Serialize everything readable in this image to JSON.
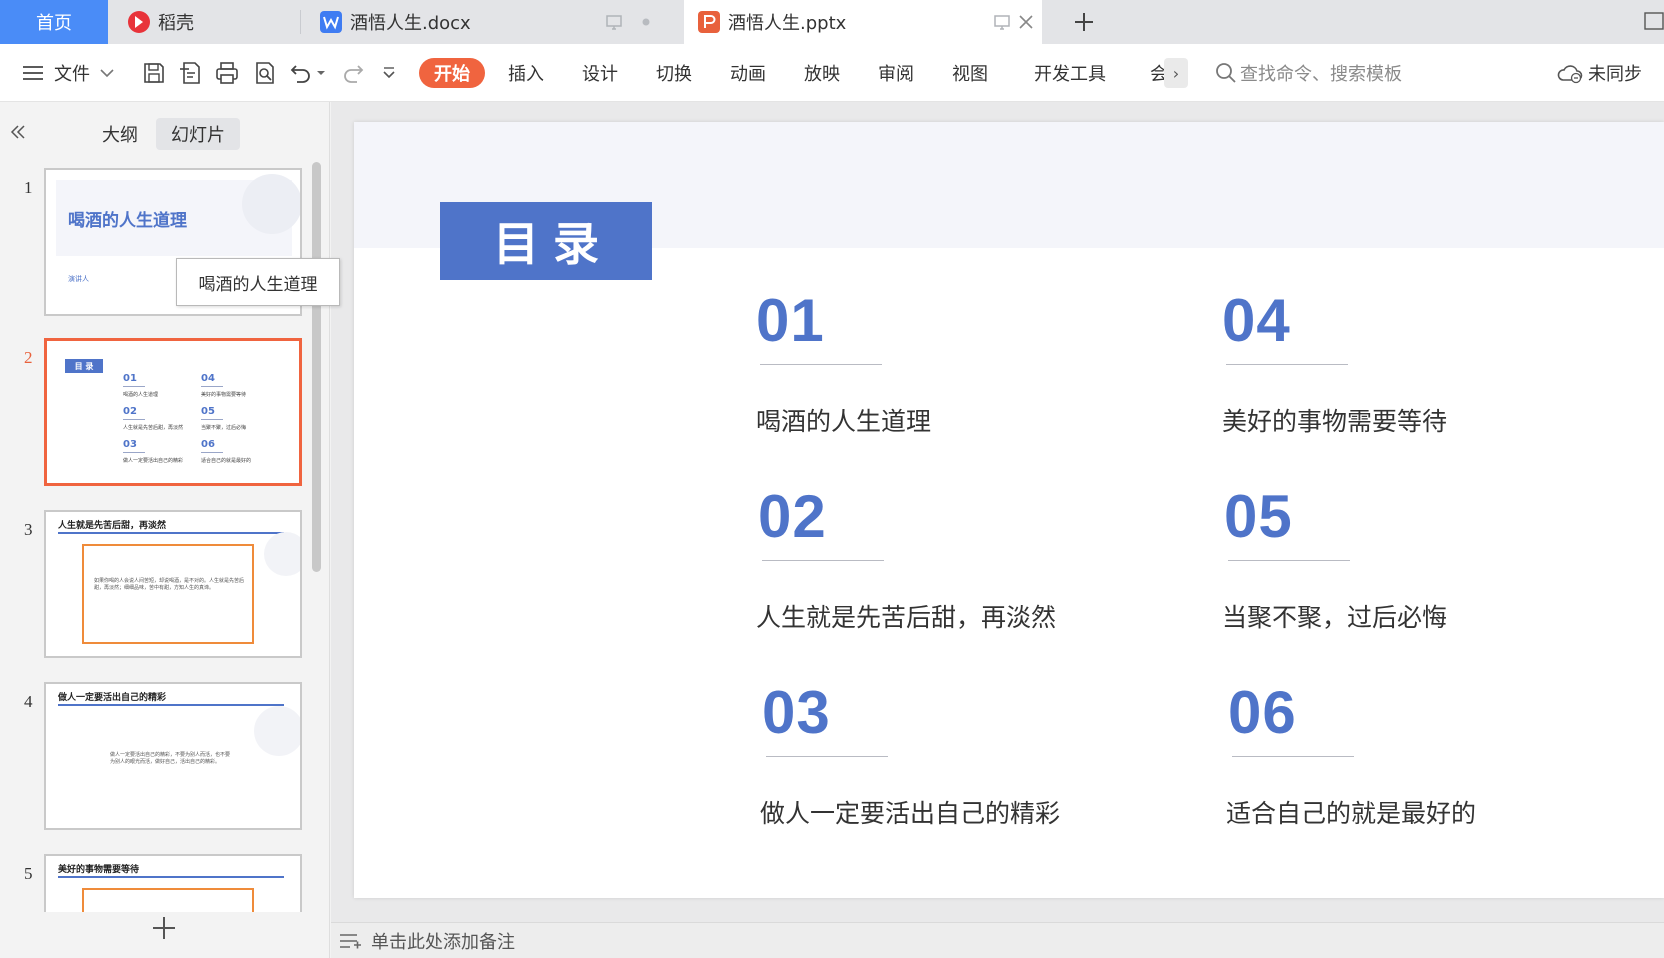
{
  "tabs": {
    "home": "首页",
    "daoke": "稻壳",
    "docx": "酒悟人生.docx",
    "pptx": "酒悟人生.pptx"
  },
  "ribbon": {
    "file_menu": "文件",
    "start": "开始",
    "items": [
      "插入",
      "设计",
      "切换",
      "动画",
      "放映",
      "审阅",
      "视图",
      "开发工具",
      "会"
    ],
    "search_placeholder": "查找命令、搜索模板",
    "sync_status": "未同步"
  },
  "panel": {
    "tab_outline": "大纲",
    "tab_slides": "幻灯片",
    "tooltip": "喝酒的人生道理",
    "slide_numbers": [
      "1",
      "2",
      "3",
      "4",
      "5"
    ],
    "thumbs": {
      "s1_title": "喝酒的人生道理",
      "s1_presenter": "演讲人",
      "s2_tag": "目 录",
      "s3_title": "人生就是先苦后甜，再淡然",
      "s3_body": "如果你喝的人会说人间苦短，却说喝酒，是不对的。人生就是先苦后甜，再淡然；细细品味，苦中有甜，方知人生的真谛。",
      "s4_title": "做人一定要活出自己的精彩",
      "s4_body": "做人一定要活出自己的精彩，不要为别人而活，也不要为别人的眼光而活，做好自己，活出自己的精彩。",
      "s5_title": "美好的事物需要等待"
    }
  },
  "slide": {
    "title": "目录",
    "items": [
      {
        "num": "01",
        "label": "喝酒的人生道理"
      },
      {
        "num": "02",
        "label": "人生就是先苦后甜，再淡然"
      },
      {
        "num": "03",
        "label": "做人一定要活出自己的精彩"
      },
      {
        "num": "04",
        "label": "美好的事物需要等待"
      },
      {
        "num": "05",
        "label": "当聚不聚，过后必悔"
      },
      {
        "num": "06",
        "label": "适合自己的就是最好的"
      }
    ]
  },
  "notes_placeholder": "单击此处添加备注",
  "colors": {
    "accent": "#4f74c9",
    "start_button": "#f0643f",
    "home_tab": "#4a8cf7",
    "active_thumb_border": "#f0643f"
  },
  "icons": [
    "hamburger-icon",
    "chevron-down-icon",
    "save-icon",
    "export-pdf-icon",
    "print-icon",
    "print-preview-icon",
    "undo-icon",
    "redo-icon",
    "customize-icon",
    "search-icon",
    "cloud-icon",
    "collapse-icon",
    "add-slide-icon",
    "notes-icon",
    "close-icon",
    "add-tab-icon",
    "monitor-icon"
  ]
}
